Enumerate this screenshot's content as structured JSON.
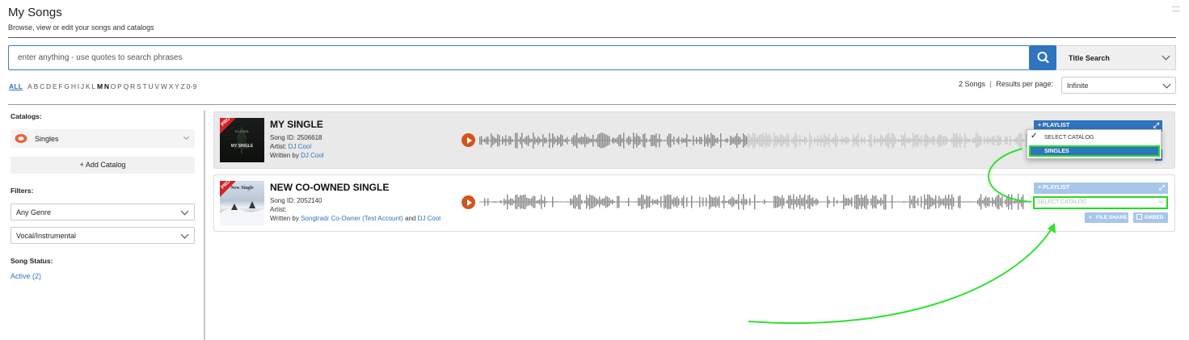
{
  "header": {
    "title": "My Songs",
    "subtitle": "Browse, view or edit your songs and catalogs"
  },
  "search": {
    "placeholder": "enter anything - use quotes to search phrases",
    "mode_label": "Title Search"
  },
  "alphabet": {
    "all_label": "ALL",
    "letters": [
      "A",
      "B",
      "C",
      "D",
      "E",
      "F",
      "G",
      "H",
      "I",
      "J",
      "K",
      "L",
      "M",
      "N",
      "O",
      "P",
      "Q",
      "R",
      "S",
      "T",
      "U",
      "V",
      "W",
      "X",
      "Y",
      "Z",
      "0-9"
    ],
    "bold_letters": [
      "M",
      "N"
    ]
  },
  "results": {
    "count_label": "2 Songs",
    "separator": "|",
    "per_page_label": "Results per page:",
    "per_page_value": "Infinite"
  },
  "sidebar": {
    "catalogs_heading": "Catalogs:",
    "catalog_name": "Singles",
    "add_catalog_label": "+ Add Catalog",
    "filters_heading": "Filters:",
    "genre_value": "Any Genre",
    "vocal_value": "Vocal/Instrumental",
    "status_heading": "Song Status:",
    "active_label": "Active (2)"
  },
  "songs": [
    {
      "title": "MY SINGLE",
      "id_label": "Song ID: 2506618",
      "artist_prefix": "Artist: ",
      "artist": "DJ Cool",
      "writer_prefix": "Written by ",
      "writers": [
        "DJ Cool"
      ],
      "art_top": "DJ COOL",
      "art_main": "MY SINGLE",
      "badge": "PRO",
      "playlist_label": "+ PLAYLIST",
      "expand_icon": "⤢",
      "progress_fraction": 0.0
    },
    {
      "title": "NEW CO-OWNED SINGLE",
      "id_label": "Song ID: 2052140",
      "artist_prefix": "Artist:",
      "artist": "",
      "writer_prefix": "Written by ",
      "writers": [
        "Songtradr Co-Owner (Test Account)",
        "DJ Cool"
      ],
      "writer_join": " and ",
      "art_top": "New Single",
      "badge": "PRO",
      "playlist_label": "+ PLAYLIST",
      "expand_icon": "⤢",
      "catalog_placeholder": "SELECT CATALOG",
      "file_share_label": "FILE SHARE",
      "embed_label": "EMBED"
    }
  ],
  "catalog_dropdown": {
    "options": [
      "SELECT CATALOG",
      "SINGLES"
    ],
    "selected_index": 1,
    "check_glyph": "✓"
  },
  "colors": {
    "accent": "#2f74bf",
    "play": "#d4541d",
    "highlight": "#22dd22",
    "badge": "#d2232a"
  }
}
